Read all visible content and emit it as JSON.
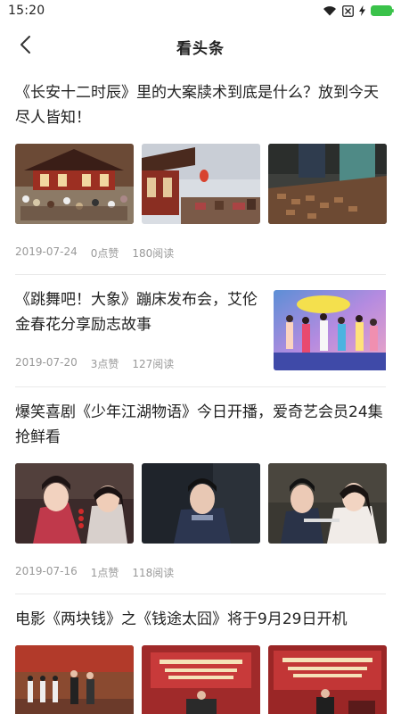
{
  "status": {
    "time": "15:20"
  },
  "nav": {
    "title": "看头条"
  },
  "articles": [
    {
      "title": "《长安十二时辰》里的大案牍术到底是什么？放到今天尽人皆知！",
      "date": "2019-07-24",
      "likes": "0点赞",
      "reads": "180阅读"
    },
    {
      "title": "《跳舞吧！大象》蹦床发布会，艾伦金春花分享励志故事",
      "date": "2019-07-20",
      "likes": "3点赞",
      "reads": "127阅读"
    },
    {
      "title": "爆笑喜剧《少年江湖物语》今日开播，爱奇艺会员24集抢鲜看",
      "date": "2019-07-16",
      "likes": "1点赞",
      "reads": "118阅读"
    },
    {
      "title": "电影《两块钱》之《钱途太囧》将于9月29日开机"
    }
  ]
}
